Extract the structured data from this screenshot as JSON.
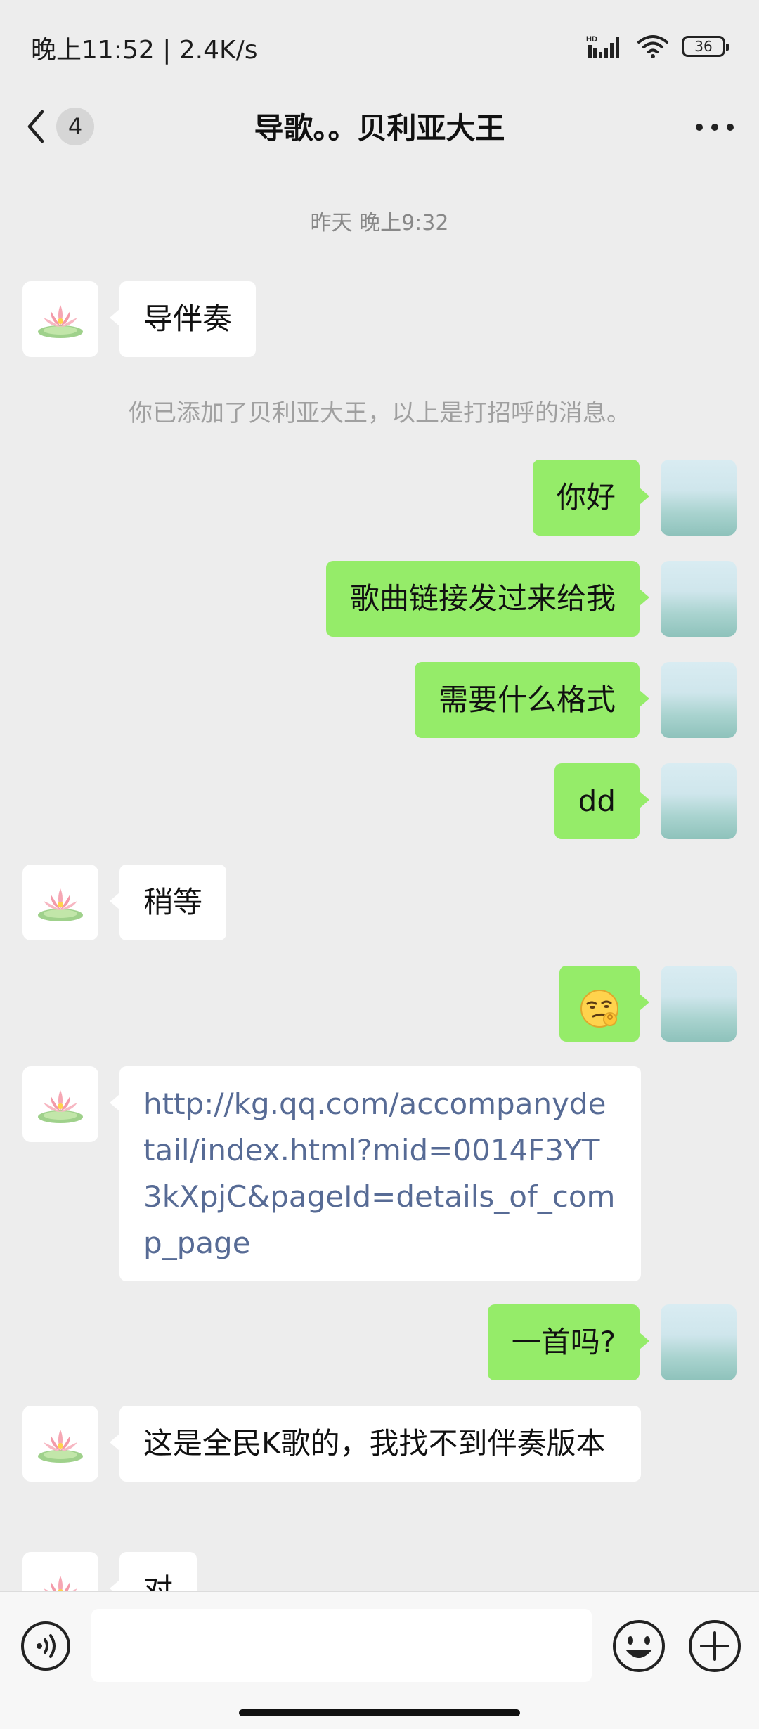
{
  "status_bar": {
    "time_speed": "晚上11:52 | 2.4K/s",
    "network_label": "HD",
    "battery": "36"
  },
  "nav": {
    "back_count": "4",
    "title": "导歌。。贝利亚大王"
  },
  "chat": {
    "timestamp": "昨天 晚上9:32",
    "system_message": "你已添加了贝利亚大王，以上是打招呼的消息。",
    "messages": [
      {
        "sender": "other",
        "text": "导伴奏"
      },
      {
        "sender": "me",
        "text": "你好"
      },
      {
        "sender": "me",
        "text": "歌曲链接发过来给我"
      },
      {
        "sender": "me",
        "text": "需要什么格式"
      },
      {
        "sender": "me",
        "text": "dd"
      },
      {
        "sender": "other",
        "text": "稍等"
      },
      {
        "sender": "me",
        "text": "",
        "emoji": "smirk-ok-emoji"
      },
      {
        "sender": "other",
        "text": "http://kg.qq.com/accompanydetail/index.html?mid=0014F3YT3kXpjC&pageId=details_of_comp_page",
        "is_link": true
      },
      {
        "sender": "me",
        "text": "一首吗?"
      },
      {
        "sender": "other",
        "text": "这是全民K歌的，我找不到伴奏版本"
      },
      {
        "sender": "other",
        "text": "对"
      }
    ]
  },
  "input": {
    "value": "",
    "placeholder": ""
  },
  "colors": {
    "background": "#ededed",
    "my_bubble": "#95ec69",
    "other_bubble": "#ffffff",
    "link": "#576b95"
  },
  "icons": [
    "back-chevron-icon",
    "more-icon",
    "voice-icon",
    "emoji-icon",
    "plus-icon",
    "lotus-avatar",
    "photo-avatar"
  ]
}
